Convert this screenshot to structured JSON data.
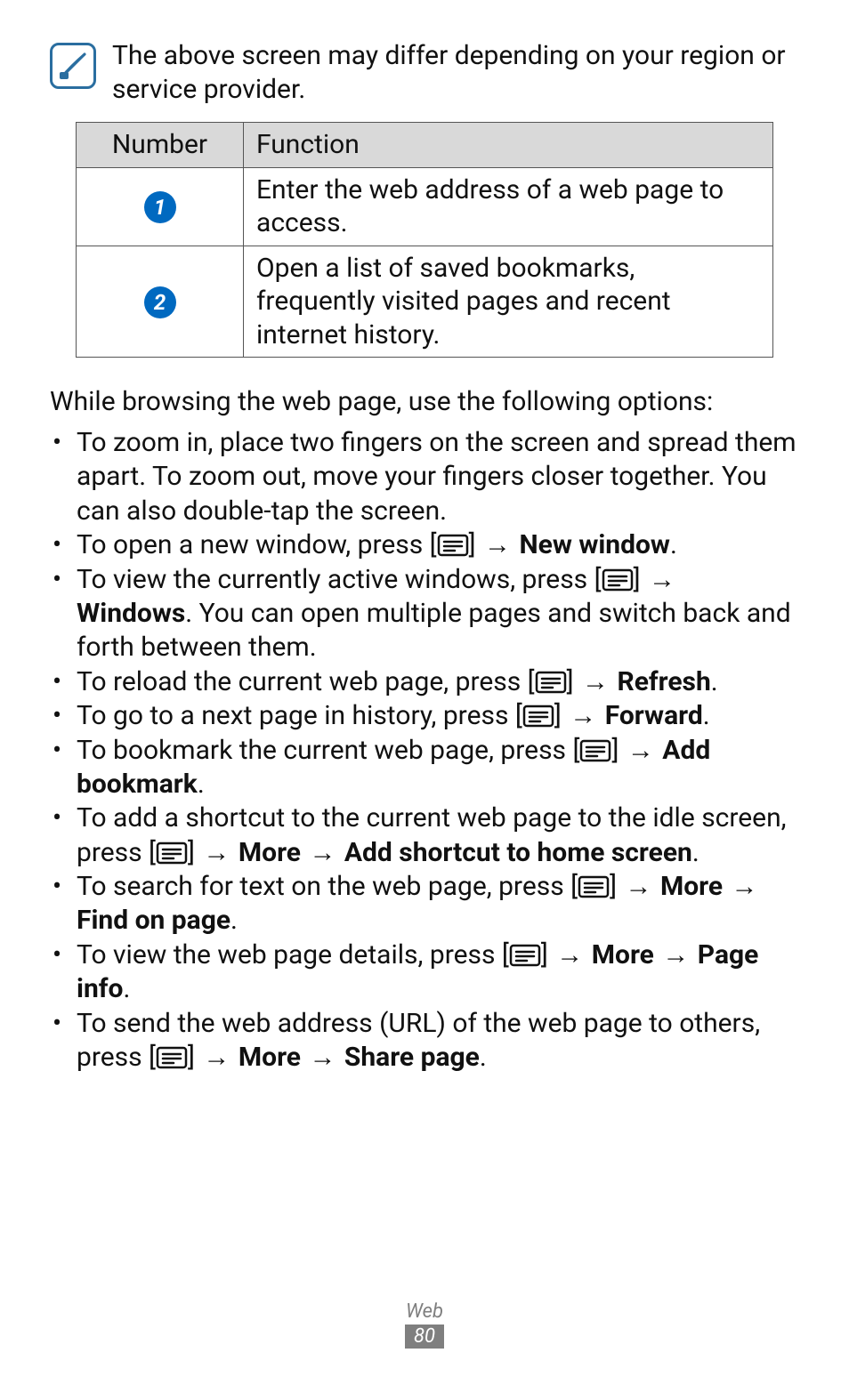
{
  "note": {
    "text": "The above screen may differ depending on your region or service provider."
  },
  "table": {
    "headers": {
      "num": "Number",
      "func": "Function"
    },
    "rows": [
      {
        "badge": "1",
        "func": "Enter the web address of a web page to access."
      },
      {
        "badge": "2",
        "func": "Open a list of saved bookmarks, frequently visited pages and recent internet history."
      }
    ]
  },
  "intro": "While browsing the web page, use the following options:",
  "arrow": "→",
  "bullets": [
    {
      "type": "plain",
      "text": "To zoom in, place two fingers on the screen and spread them apart. To zoom out, move your fingers closer together. You can also double-tap the screen."
    },
    {
      "type": "menu_then_bold_end",
      "pre": "To open a new window, press [",
      "post": "] ",
      "bold_end": "New window",
      "tail": "."
    },
    {
      "type": "menu_then_plain_then_bold_block",
      "pre": "To view the currently active windows, press [",
      "post": "] ",
      "bold_start": "Windows",
      "after": ". You can open multiple pages and switch back and forth between them."
    },
    {
      "type": "menu_then_bold_end",
      "pre": "To reload the current web page, press [",
      "post": "] ",
      "bold_end": "Refresh",
      "tail": "."
    },
    {
      "type": "menu_then_bold_end",
      "pre": "To go to a next page in history, press [",
      "post": "] ",
      "bold_end": "Forward",
      "tail": "."
    },
    {
      "type": "menu_then_bold_chain_end",
      "pre": "To bookmark the current web page, press [",
      "post": "] ",
      "bold_chain": [
        "Add bookmark"
      ],
      "tail": "."
    },
    {
      "type": "text_then_menu_then_bold_chain",
      "pre1": "To add a shortcut to the current web page to the idle screen, press [",
      "post1": "] ",
      "bold_chain": [
        "More",
        "Add shortcut to home screen"
      ],
      "tail": "."
    },
    {
      "type": "text_then_menu_then_bold_chain_tail_before",
      "pre1": "To search for text on the web page, press [",
      "post1": "] ",
      "bold_chain": [
        "More",
        "Find on page"
      ],
      "tail": "."
    },
    {
      "type": "text_then_menu_then_bold_chain_tail_before",
      "pre1": "To view the web page details, press [",
      "post1": "] ",
      "bold_chain": [
        "More",
        "Page info"
      ],
      "tail": "."
    },
    {
      "type": "text_then_menu_then_bold_chain_tail_before",
      "pre1": "To send the web address (URL) of the web page to others, press [",
      "post1": "] ",
      "bold_chain": [
        "More",
        "Share page"
      ],
      "tail": "."
    }
  ],
  "footer": {
    "section": "Web",
    "page": "80"
  }
}
